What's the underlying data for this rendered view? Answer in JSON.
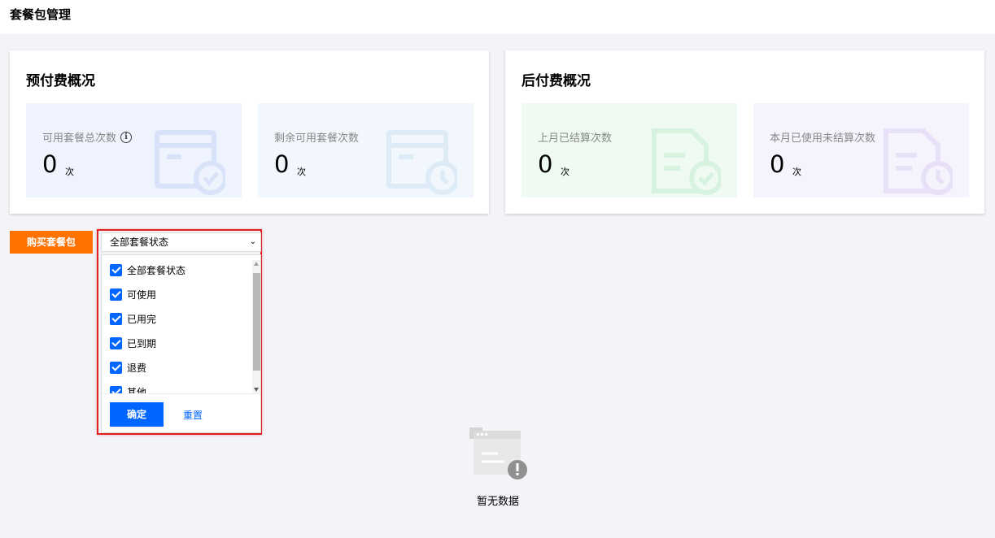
{
  "page": {
    "title": "套餐包管理"
  },
  "prepaid": {
    "title": "预付费概况",
    "cards": [
      {
        "label": "可用套餐总次数",
        "value": "0",
        "unit": "次",
        "icon": "info-icon"
      },
      {
        "label": "剩余可用套餐次数",
        "value": "0",
        "unit": "次"
      }
    ]
  },
  "postpaid": {
    "title": "后付费概况",
    "cards": [
      {
        "label": "上月已结算次数",
        "value": "0",
        "unit": "次"
      },
      {
        "label": "本月已使用未结算次数",
        "value": "0",
        "unit": "次"
      }
    ]
  },
  "toolbar": {
    "buy_label": "购买套餐包",
    "status_select": {
      "value": "全部套餐状态",
      "icon": "chevron-down-icon"
    }
  },
  "dropdown": {
    "options": [
      {
        "label": "全部套餐状态",
        "checked": true
      },
      {
        "label": "可使用",
        "checked": true
      },
      {
        "label": "已用完",
        "checked": true
      },
      {
        "label": "已到期",
        "checked": true
      },
      {
        "label": "退费",
        "checked": true
      },
      {
        "label": "其他",
        "checked": true
      }
    ],
    "confirm_label": "确定",
    "reset_label": "重置"
  },
  "empty_state": {
    "text": "暂无数据",
    "icon": "empty-data-icon"
  },
  "colors": {
    "accent": "#0066ff",
    "buy": "#ff7200",
    "highlight": "#e02020"
  }
}
